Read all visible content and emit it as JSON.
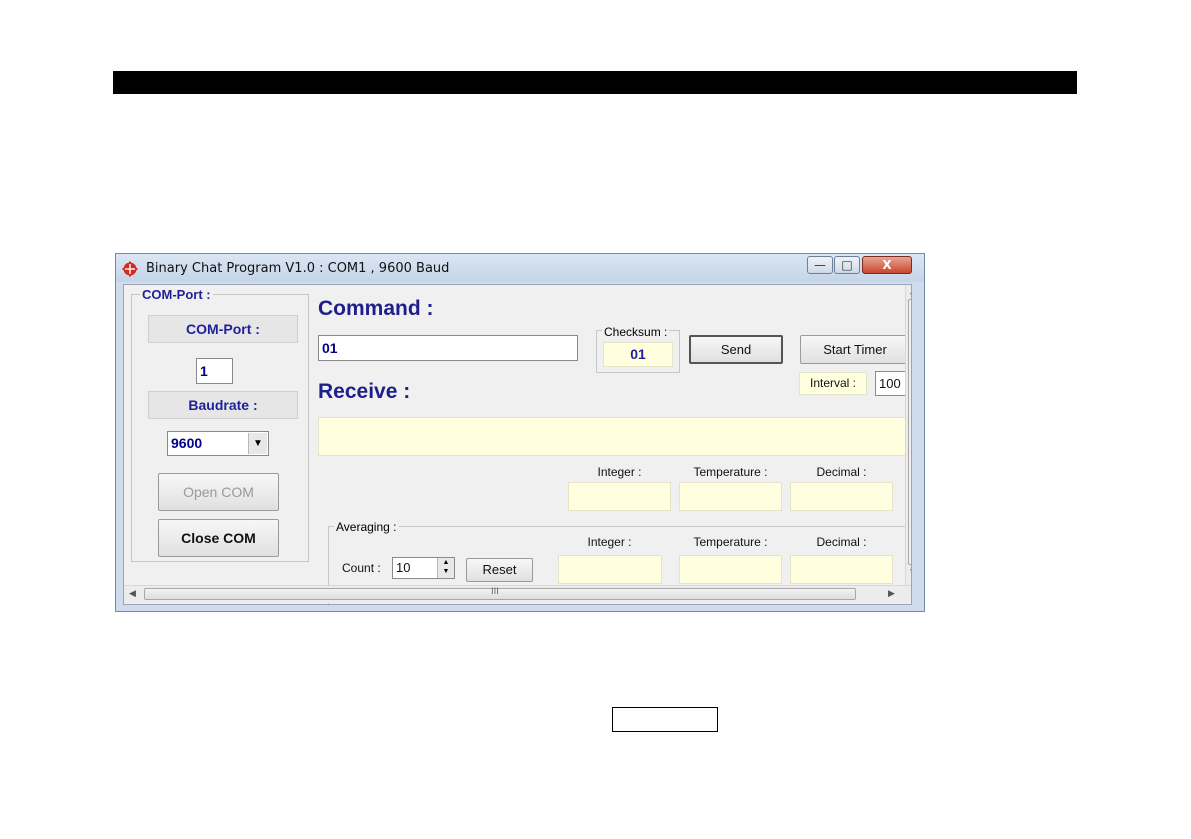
{
  "window": {
    "title": "Binary Chat Program V1.0 : COM1 , 9600 Baud",
    "controls": {
      "minimize": "—",
      "maximize": "□",
      "close": "X"
    }
  },
  "com_port_group": {
    "title": "COM-Port :",
    "port_label": "COM-Port :",
    "port_value": "1",
    "baud_label": "Baudrate :",
    "baud_value": "9600",
    "open_button": "Open COM",
    "close_button": "Close COM"
  },
  "command": {
    "heading": "Command :",
    "value": "01",
    "checksum_label": "Checksum :",
    "checksum_value": "01",
    "send_button": "Send",
    "start_timer_button": "Start Timer",
    "interval_label": "Interval :",
    "interval_value": "100"
  },
  "receive": {
    "heading": "Receive :",
    "value": "",
    "integer_label": "Integer :",
    "temperature_label": "Temperature :",
    "decimal_label": "Decimal :"
  },
  "averaging": {
    "title": "Averaging :",
    "count_label": "Count :",
    "count_value": "10",
    "reset_button": "Reset",
    "integer_label": "Integer :",
    "temperature_label": "Temperature :",
    "decimal_label": "Decimal :"
  },
  "scrollbar": {
    "h_grip": "III",
    "v_grip": "≡"
  },
  "colors": {
    "accent_text": "#1f1f9c",
    "readout_bg": "#ffffe0"
  }
}
